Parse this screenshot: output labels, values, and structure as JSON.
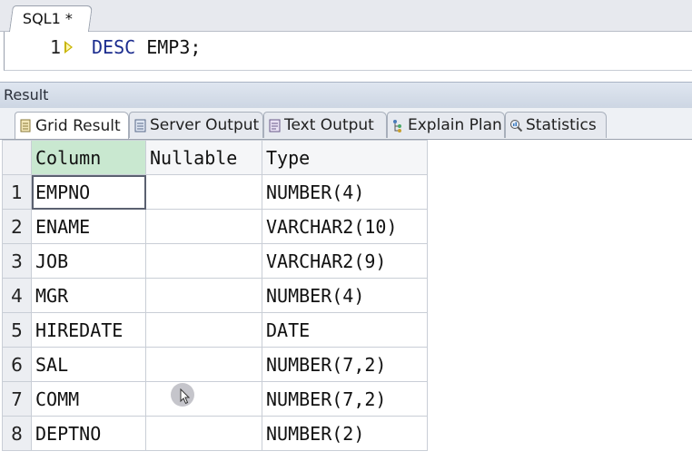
{
  "editor": {
    "tab_label": "SQL1 *",
    "line_number": "1",
    "keyword": "DESC",
    "rest": " EMP3;"
  },
  "result": {
    "title": "Result",
    "tabs": [
      {
        "label": "Grid Result",
        "icon": "grid-result-icon"
      },
      {
        "label": "Server Output",
        "icon": "server-output-icon"
      },
      {
        "label": "Text Output",
        "icon": "text-output-icon"
      },
      {
        "label": "Explain Plan",
        "icon": "explain-plan-icon"
      },
      {
        "label": "Statistics",
        "icon": "statistics-icon"
      }
    ],
    "active_tab": "Grid Result"
  },
  "grid": {
    "headers": [
      "Column",
      "Nullable",
      "Type"
    ],
    "rows": [
      {
        "num": "1",
        "column": "EMPNO",
        "nullable": "",
        "type": "NUMBER(4)"
      },
      {
        "num": "2",
        "column": "ENAME",
        "nullable": "",
        "type": "VARCHAR2(10)"
      },
      {
        "num": "3",
        "column": "JOB",
        "nullable": "",
        "type": "VARCHAR2(9)"
      },
      {
        "num": "4",
        "column": "MGR",
        "nullable": "",
        "type": "NUMBER(4)"
      },
      {
        "num": "5",
        "column": "HIREDATE",
        "nullable": "",
        "type": "DATE"
      },
      {
        "num": "6",
        "column": "SAL",
        "nullable": "",
        "type": "NUMBER(7,2)"
      },
      {
        "num": "7",
        "column": "COMM",
        "nullable": "",
        "type": "NUMBER(7,2)"
      },
      {
        "num": "8",
        "column": "DEPTNO",
        "nullable": "",
        "type": "NUMBER(2)"
      }
    ]
  },
  "colors": {
    "keyword": "#1c2d8f",
    "selected_header": "#c9e8d0",
    "run_arrow": "#c8b400"
  }
}
